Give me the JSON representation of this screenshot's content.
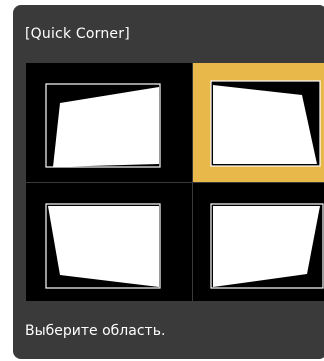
{
  "dialog": {
    "title": "[Quick Corner]",
    "instruction": "Выберите область.",
    "selected_area": "top-right"
  },
  "areas": [
    {
      "id": "top-left",
      "selected": false
    },
    {
      "id": "top-right",
      "selected": true
    },
    {
      "id": "bottom-left",
      "selected": false
    },
    {
      "id": "bottom-right",
      "selected": false
    }
  ],
  "colors": {
    "panel": "#3a3a3a",
    "selection": "#e9b84a",
    "preview_background": "#000000",
    "image": "#ffffff"
  }
}
